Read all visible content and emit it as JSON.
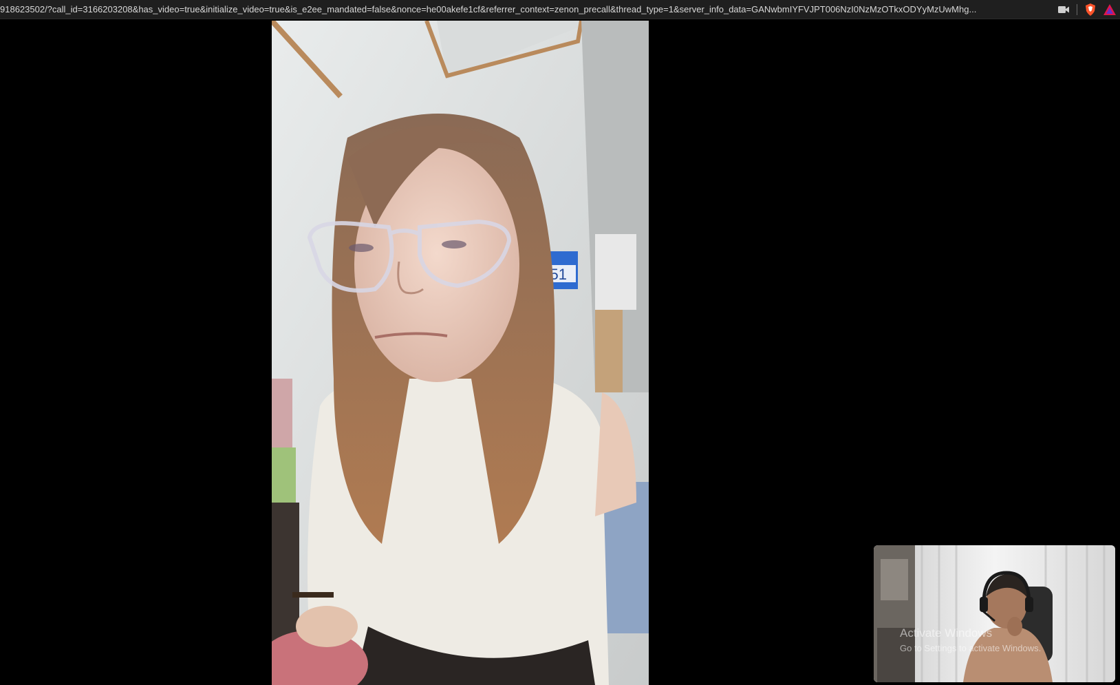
{
  "browser": {
    "url": "918623502/?call_id=3166203208&has_video=true&initialize_video=true&is_e2ee_mandated=false&nonce=he00akefe1cf&referrer_context=zenon_precall&thread_type=1&server_info_data=GANwbmIYFVJPT006NzI0NzMzOTkxODYyMzUwMhg...",
    "icons": [
      "camera-icon",
      "brave-shield-icon",
      "brave-rewards-icon"
    ]
  },
  "call": {
    "remote_video": {
      "icon": "remote-participant-video"
    },
    "self_view": {
      "icon": "self-view-video"
    },
    "remote_scene_text": "6251"
  },
  "watermark": {
    "title": "Activate Windows",
    "subtitle": "Go to Settings to activate Windows."
  },
  "colors": {
    "addressbar_bg": "#1f1f1f",
    "brave_orange": "#fb542b",
    "background": "#000000"
  }
}
